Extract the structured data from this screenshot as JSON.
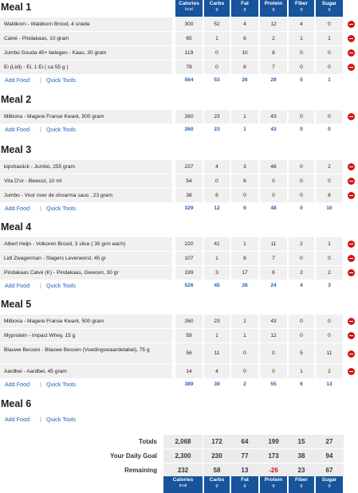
{
  "columns": [
    {
      "name": "Calories",
      "unit": "kcal"
    },
    {
      "name": "Carbs",
      "unit": "g"
    },
    {
      "name": "Fat",
      "unit": "g"
    },
    {
      "name": "Protein",
      "unit": "g"
    },
    {
      "name": "Fiber",
      "unit": "g"
    },
    {
      "name": "Sugar",
      "unit": "g"
    }
  ],
  "links": {
    "add_food": "Add Food",
    "separator": "|",
    "quick_tools": "Quick Tools"
  },
  "meals": [
    {
      "title": "Meal 1",
      "rows": [
        {
          "food": "Waldkorn - Waldkorn Brood, 4 snede",
          "values": [
            "300",
            "52",
            "4",
            "12",
            "4",
            "0"
          ]
        },
        {
          "food": "Calvé - Pindakaas, 10 gram",
          "values": [
            "65",
            "1",
            "6",
            "2",
            "1",
            "1"
          ]
        },
        {
          "food": "Jumbo Gouda 45+ belegen - Kaas, 30 gram",
          "values": [
            "119",
            "0",
            "10",
            "8",
            "0",
            "0"
          ]
        },
        {
          "food": "Ei (Lidl) - Ei, 1 Ei ( ca 55 g )",
          "values": [
            "79",
            "0",
            "6",
            "7",
            "0",
            "0"
          ]
        }
      ],
      "totals": [
        "564",
        "53",
        "26",
        "29",
        "5",
        "1"
      ]
    },
    {
      "title": "Meal 2",
      "rows": [
        {
          "food": "Milbona - Magere Franse Kwark, 500 gram",
          "values": [
            "260",
            "23",
            "1",
            "43",
            "0",
            "0"
          ]
        }
      ],
      "totals": [
        "260",
        "23",
        "1",
        "43",
        "0",
        "0"
      ]
    },
    {
      "title": "Meal 3",
      "rows": [
        {
          "food": "kipshaslick - Jumbo, 255 gram",
          "values": [
            "237",
            "4",
            "3",
            "48",
            "0",
            "2"
          ]
        },
        {
          "food": "Vita D'or - Bewust, 10 ml",
          "values": [
            "54",
            "0",
            "6",
            "0",
            "0",
            "0"
          ]
        },
        {
          "food": "Jumbo - Voor over de shoarma saus , 23 gram",
          "values": [
            "38",
            "8",
            "0",
            "0",
            "0",
            "8"
          ]
        }
      ],
      "totals": [
        "329",
        "12",
        "9",
        "48",
        "0",
        "10"
      ]
    },
    {
      "title": "Meal 4",
      "rows": [
        {
          "food": "Albert Heijn - Volkoren Brood, 3 slice ( 35 grm each)",
          "values": [
            "220",
            "41",
            "1",
            "11",
            "2",
            "1"
          ]
        },
        {
          "food": "Lidl Zwagerman - Slagers Leverworst, 45 gr",
          "values": [
            "107",
            "1",
            "8",
            "7",
            "0",
            "0"
          ]
        },
        {
          "food": "Pindakaas Calvé (K) - Pindakaas, Gewoon, 30 gr",
          "values": [
            "199",
            "3",
            "17",
            "6",
            "2",
            "2"
          ]
        }
      ],
      "totals": [
        "526",
        "45",
        "26",
        "24",
        "4",
        "3"
      ]
    },
    {
      "title": "Meal 5",
      "rows": [
        {
          "food": "Milbona - Magere Franse Kwark, 500 gram",
          "values": [
            "260",
            "23",
            "1",
            "43",
            "0",
            "0"
          ]
        },
        {
          "food": "Myprotein - Impact Whey, 15 g",
          "values": [
            "59",
            "1",
            "1",
            "12",
            "0",
            "0"
          ]
        },
        {
          "food": "Blauwe Bessen - Blauwe Bessen (Voedingswaardetabel), 75 g",
          "values": [
            "56",
            "11",
            "0",
            "0",
            "5",
            "11"
          ],
          "tall": true
        },
        {
          "food": "Aardbei - Aardbei, 45 gram",
          "values": [
            "14",
            "4",
            "0",
            "0",
            "1",
            "2"
          ]
        }
      ],
      "totals": [
        "389",
        "39",
        "2",
        "55",
        "6",
        "13"
      ]
    },
    {
      "title": "Meal 6",
      "rows": [],
      "totals": []
    }
  ],
  "summary": [
    {
      "label": "Totals",
      "values": [
        "2,068",
        "172",
        "64",
        "199",
        "15",
        "27"
      ]
    },
    {
      "label": "Your Daily Goal",
      "values": [
        "2,300",
        "230",
        "77",
        "173",
        "38",
        "94"
      ]
    },
    {
      "label": "Remaining",
      "values": [
        "232",
        "58",
        "13",
        "-26",
        "23",
        "67"
      ]
    }
  ],
  "colors": {
    "header": "#17549b",
    "link": "#2262b5",
    "delete": "#d01515",
    "negative": "#d01515"
  }
}
